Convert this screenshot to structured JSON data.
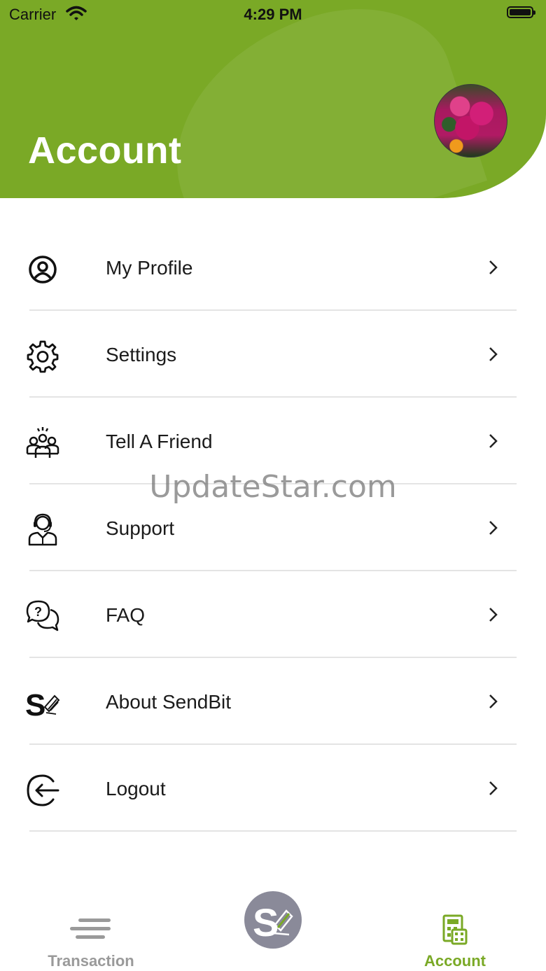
{
  "status_bar": {
    "carrier": "Carrier",
    "time": "4:29 PM"
  },
  "header": {
    "title": "Account",
    "accent_color": "#7aa926"
  },
  "menu": {
    "items": [
      {
        "label": "My Profile",
        "icon": "user-circle-icon"
      },
      {
        "label": "Settings",
        "icon": "gear-icon"
      },
      {
        "label": "Tell A Friend",
        "icon": "group-icon"
      },
      {
        "label": "Support",
        "icon": "headset-agent-icon"
      },
      {
        "label": "FAQ",
        "icon": "question-chat-icon"
      },
      {
        "label": "About SendBit",
        "icon": "sendbit-logo-icon"
      },
      {
        "label": "Logout",
        "icon": "logout-icon"
      }
    ]
  },
  "watermark": "UpdateStar.com",
  "tabbar": {
    "tabs": [
      {
        "label": "Transaction",
        "icon": "transaction-lines-icon",
        "active": false
      },
      {
        "label": "",
        "icon": "sendbit-logo-icon",
        "active": false
      },
      {
        "label": "Account",
        "icon": "calculator-icon",
        "active": true
      }
    ],
    "active_color": "#7aa926",
    "inactive_color": "#9a9a9a"
  }
}
